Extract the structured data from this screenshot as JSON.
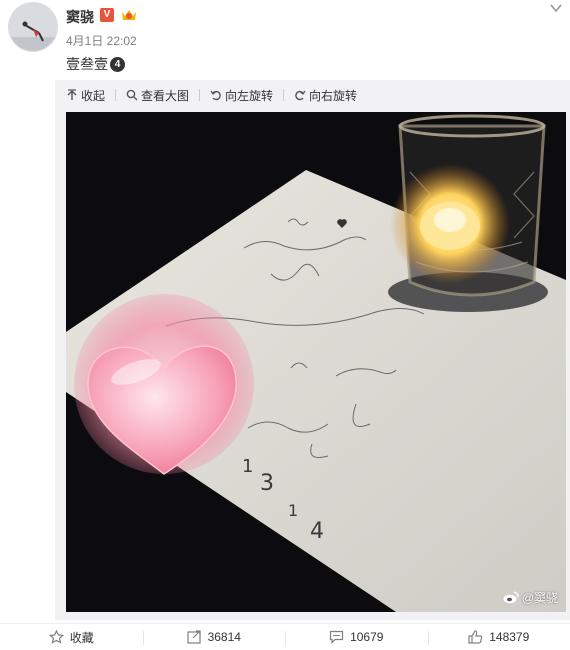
{
  "post": {
    "username": "窦骁",
    "vip_badge": "V",
    "time": "4月1日 22:02",
    "text": "壹叁壹",
    "text_badge": "4"
  },
  "toolbar": {
    "collapse": "收起",
    "view_large": "查看大图",
    "rotate_left": "向左旋转",
    "rotate_right": "向右旋转"
  },
  "image": {
    "watermark": "@窦骁",
    "note_lines": [
      "Love is",
      "not what they say",
      "you",
      "leave me a wish, I'll come back",
      "to \"you\"",
      "thank you"
    ],
    "note_digits": [
      "1",
      "3",
      "1",
      "4"
    ]
  },
  "actions": {
    "favorite": "收藏",
    "repost": "36814",
    "comment": "10679",
    "like": "148379"
  },
  "colors": {
    "accent_orange": "#e8543e",
    "muted_text": "#808080",
    "heart_pink": "#f27a98"
  }
}
